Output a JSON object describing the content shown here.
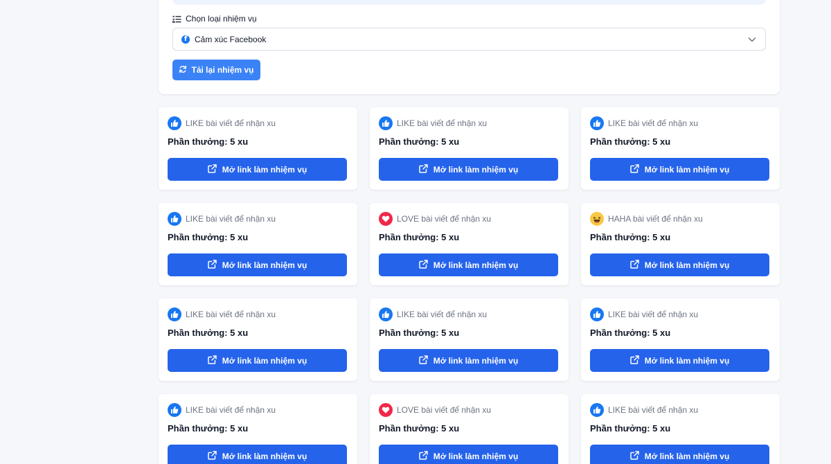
{
  "filter": {
    "label": "Chọn loại nhiệm vụ",
    "selected": "Cảm xúc Facebook",
    "reload_label": "Tải lại nhiệm vụ"
  },
  "colors": {
    "primary_button": "#2563eb",
    "reload_button": "#3b82f6",
    "like": "#1877f2",
    "love": "#f02849",
    "haha": "#f7c843"
  },
  "tasks": [
    {
      "reaction": "like",
      "icon": "thumbs-up-icon",
      "title": "LIKE bài viết để nhận xu",
      "reward": "Phần thưởng: 5 xu",
      "button": "Mở link làm nhiệm vụ"
    },
    {
      "reaction": "like",
      "icon": "thumbs-up-icon",
      "title": "LIKE bài viết để nhận xu",
      "reward": "Phần thưởng: 5 xu",
      "button": "Mở link làm nhiệm vụ"
    },
    {
      "reaction": "like",
      "icon": "thumbs-up-icon",
      "title": "LIKE bài viết để nhận xu",
      "reward": "Phần thưởng: 5 xu",
      "button": "Mở link làm nhiệm vụ"
    },
    {
      "reaction": "like",
      "icon": "thumbs-up-icon",
      "title": "LIKE bài viết để nhận xu",
      "reward": "Phần thưởng: 5 xu",
      "button": "Mở link làm nhiệm vụ"
    },
    {
      "reaction": "love",
      "icon": "heart-icon",
      "title": "LOVE bài viết để nhận xu",
      "reward": "Phần thưởng: 5 xu",
      "button": "Mở link làm nhiệm vụ"
    },
    {
      "reaction": "haha",
      "icon": "laughing-face-icon",
      "title": "HAHA bài viết để nhận xu",
      "reward": "Phần thưởng: 5 xu",
      "button": "Mở link làm nhiệm vụ"
    },
    {
      "reaction": "like",
      "icon": "thumbs-up-icon",
      "title": "LIKE bài viết để nhận xu",
      "reward": "Phần thưởng: 5 xu",
      "button": "Mở link làm nhiệm vụ"
    },
    {
      "reaction": "like",
      "icon": "thumbs-up-icon",
      "title": "LIKE bài viết để nhận xu",
      "reward": "Phần thưởng: 5 xu",
      "button": "Mở link làm nhiệm vụ"
    },
    {
      "reaction": "like",
      "icon": "thumbs-up-icon",
      "title": "LIKE bài viết để nhận xu",
      "reward": "Phần thưởng: 5 xu",
      "button": "Mở link làm nhiệm vụ"
    },
    {
      "reaction": "like",
      "icon": "thumbs-up-icon",
      "title": "LIKE bài viết để nhận xu",
      "reward": "Phần thưởng: 5 xu",
      "button": "Mở link làm nhiệm vụ"
    },
    {
      "reaction": "love",
      "icon": "heart-icon",
      "title": "LOVE bài viết để nhận xu",
      "reward": "Phần thưởng: 5 xu",
      "button": "Mở link làm nhiệm vụ"
    },
    {
      "reaction": "like",
      "icon": "thumbs-up-icon",
      "title": "LIKE bài viết để nhận xu",
      "reward": "Phần thưởng: 5 xu",
      "button": "Mở link làm nhiệm vụ"
    }
  ]
}
